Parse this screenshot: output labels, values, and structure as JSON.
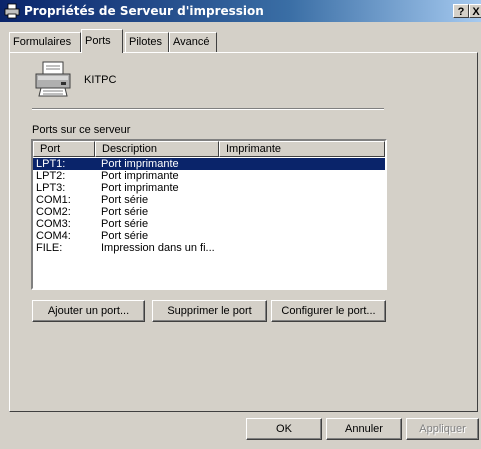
{
  "window": {
    "title": "Propriétés de Serveur d'impression",
    "help_label": "?",
    "close_label": "X"
  },
  "tabs": [
    {
      "label": "Formulaires"
    },
    {
      "label": "Ports",
      "active": true
    },
    {
      "label": "Pilotes"
    },
    {
      "label": "Avancé"
    }
  ],
  "server": {
    "name": "KITPC"
  },
  "ports_section": {
    "label": "Ports sur ce serveur",
    "columns": [
      "Port",
      "Description",
      "Imprimante"
    ],
    "rows": [
      {
        "port": "LPT1:",
        "description": "Port imprimante",
        "printer": "",
        "selected": true
      },
      {
        "port": "LPT2:",
        "description": "Port imprimante",
        "printer": ""
      },
      {
        "port": "LPT3:",
        "description": "Port imprimante",
        "printer": ""
      },
      {
        "port": "COM1:",
        "description": "Port série",
        "printer": ""
      },
      {
        "port": "COM2:",
        "description": "Port série",
        "printer": ""
      },
      {
        "port": "COM3:",
        "description": "Port série",
        "printer": ""
      },
      {
        "port": "COM4:",
        "description": "Port série",
        "printer": ""
      },
      {
        "port": "FILE:",
        "description": "Impression dans un fi...",
        "printer": ""
      }
    ]
  },
  "port_buttons": {
    "add": "Ajouter un port...",
    "delete": "Supprimer le port",
    "configure": "Configurer le port..."
  },
  "dialog_buttons": {
    "ok": "OK",
    "cancel": "Annuler",
    "apply": "Appliquer"
  },
  "colors": {
    "title_bar": "#0a246a",
    "selection": "#0a246a",
    "face": "#d4d0c8"
  }
}
